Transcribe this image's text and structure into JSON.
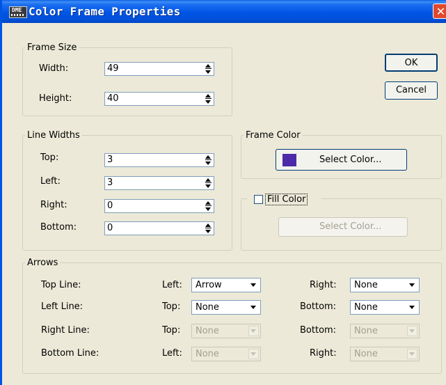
{
  "window": {
    "title": "Color Frame Properties",
    "icon_text": "DME",
    "close_symbol": "✕"
  },
  "buttons": {
    "ok": "OK",
    "cancel": "Cancel"
  },
  "frame_size": {
    "legend": "Frame Size",
    "width_label": "Width:",
    "width_value": "49",
    "height_label": "Height:",
    "height_value": "40"
  },
  "line_widths": {
    "legend": "Line Widths",
    "top_label": "Top:",
    "top_value": "3",
    "left_label": "Left:",
    "left_value": "3",
    "right_label": "Right:",
    "right_value": "0",
    "bottom_label": "Bottom:",
    "bottom_value": "0"
  },
  "frame_color": {
    "legend": "Frame Color",
    "button_label": "Select Color...",
    "swatch_color": "#4d2aa8"
  },
  "fill_color": {
    "label": "Fill Color",
    "checked": false,
    "button_label": "Select Color..."
  },
  "arrows": {
    "legend": "Arrows",
    "rows": [
      {
        "name": "Top Line:",
        "a_label": "Left:",
        "a_value": "Arrow",
        "b_label": "Right:",
        "b_value": "None",
        "enabled": true
      },
      {
        "name": "Left Line:",
        "a_label": "Top:",
        "a_value": "None",
        "b_label": "Bottom:",
        "b_value": "None",
        "enabled": true
      },
      {
        "name": "Right Line:",
        "a_label": "Top:",
        "a_value": "None",
        "b_label": "Bottom:",
        "b_value": "None",
        "enabled": false
      },
      {
        "name": "Bottom Line:",
        "a_label": "Left:",
        "a_value": "None",
        "b_label": "Right:",
        "b_value": "None",
        "enabled": false
      }
    ]
  }
}
